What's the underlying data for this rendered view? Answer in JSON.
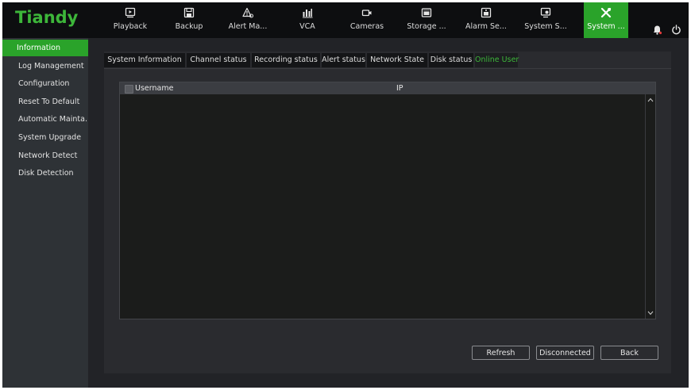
{
  "brand": {
    "logo": "Tiandy",
    "accent": "#2aa32a"
  },
  "nav": [
    {
      "label": "Playback",
      "icon": "playback-icon"
    },
    {
      "label": "Backup",
      "icon": "save-icon"
    },
    {
      "label": "Alert Ma...",
      "icon": "alert-icon"
    },
    {
      "label": "VCA",
      "icon": "bar-chart-icon"
    },
    {
      "label": "Cameras",
      "icon": "camera-icon"
    },
    {
      "label": "Storage ...",
      "icon": "storage-icon"
    },
    {
      "label": "Alarm Se...",
      "icon": "alarm-device-icon"
    },
    {
      "label": "System S...",
      "icon": "monitor-settings-icon"
    },
    {
      "label": "System ...",
      "icon": "tools-icon",
      "active": true
    }
  ],
  "header_icons": [
    "bell-icon",
    "power-icon"
  ],
  "sidebar": {
    "items": [
      {
        "label": "Information",
        "active": true
      },
      {
        "label": "Log Management"
      },
      {
        "label": "Configuration"
      },
      {
        "label": "Reset To Default"
      },
      {
        "label": "Automatic Mainta..."
      },
      {
        "label": "System Upgrade"
      },
      {
        "label": "Network Detect"
      },
      {
        "label": "Disk Detection"
      }
    ]
  },
  "tabs": [
    {
      "label": "System Information"
    },
    {
      "label": "Channel status"
    },
    {
      "label": "Recording status"
    },
    {
      "label": "Alert status"
    },
    {
      "label": "Network State"
    },
    {
      "label": "Disk status"
    },
    {
      "label": "Online User",
      "active": true
    }
  ],
  "table": {
    "columns": [
      "Username",
      "IP"
    ],
    "rows": []
  },
  "buttons": {
    "refresh": "Refresh",
    "disconnected": "Disconnected",
    "back": "Back"
  }
}
